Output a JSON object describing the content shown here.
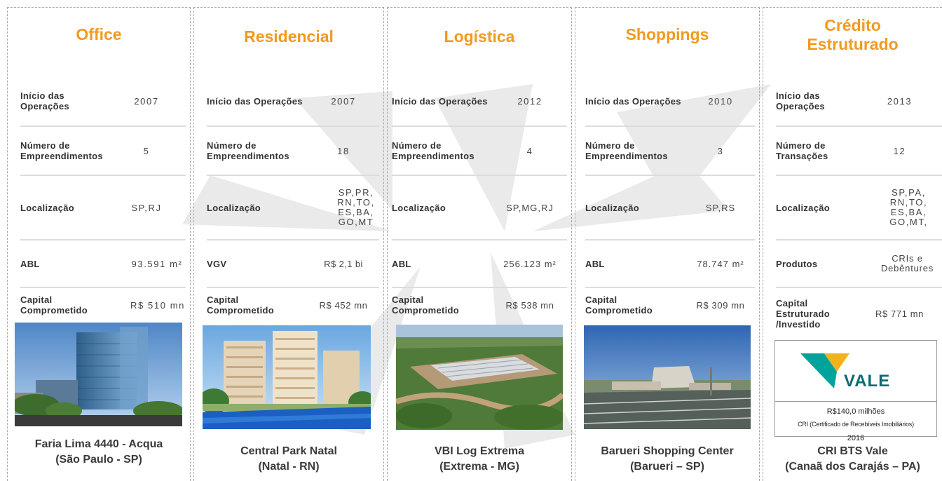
{
  "columns": [
    {
      "title_line1": "Office",
      "title_line2": "",
      "rows": [
        {
          "label": "Início das Operações",
          "value": "2007"
        },
        {
          "label": "Número de Empreendimentos",
          "value": "5"
        },
        {
          "label": "Localização",
          "value": "SP,RJ"
        },
        {
          "label": "ABL",
          "value": "93.591 m²"
        },
        {
          "label": "Capital Comprometido",
          "value": "R$ 510 mn"
        }
      ],
      "photo_icon": "office-tower-photo",
      "caption_line1": "Faria Lima 4440 - Acqua",
      "caption_line2": "(São Paulo - SP)"
    },
    {
      "title_line1": "Residencial",
      "title_line2": "",
      "rows": [
        {
          "label": "Início das Operações",
          "value": "2007"
        },
        {
          "label": "Número de Empreendimentos",
          "value": "18"
        },
        {
          "label": "Localização",
          "value": "SP,PR, RN,TO, ES,BA, GO,MT"
        },
        {
          "label": "VGV",
          "value": "R$ 2,1 bi"
        },
        {
          "label": "Capital Comprometido",
          "value": "R$ 452 mn"
        }
      ],
      "photo_icon": "residential-towers-photo",
      "caption_line1": "Central Park Natal",
      "caption_line2": "(Natal - RN)"
    },
    {
      "title_line1": "Logística",
      "title_line2": "",
      "rows": [
        {
          "label": "Início das Operações",
          "value": "2012"
        },
        {
          "label": "Número de Empreendimentos",
          "value": "4"
        },
        {
          "label": "Localização",
          "value": "SP,MG,RJ"
        },
        {
          "label": "ABL",
          "value": "256.123 m²"
        },
        {
          "label": "Capital Comprometido",
          "value": "R$ 538 mn"
        }
      ],
      "photo_icon": "logistics-warehouse-photo",
      "caption_line1": "VBI Log Extrema",
      "caption_line2": "(Extrema - MG)"
    },
    {
      "title_line1": "Shoppings",
      "title_line2": "",
      "rows": [
        {
          "label": "Início das Operações",
          "value": "2010"
        },
        {
          "label": "Número de Empreendimentos",
          "value": "3"
        },
        {
          "label": "Localização",
          "value": "SP,RS"
        },
        {
          "label": "ABL",
          "value": "78.747 m²"
        },
        {
          "label": "Capital Comprometido",
          "value": "R$ 309 mn"
        }
      ],
      "photo_icon": "shopping-center-photo",
      "caption_line1": "Barueri Shopping Center",
      "caption_line2": "(Barueri – SP)"
    },
    {
      "title_line1": "Crédito",
      "title_line2": "Estruturado",
      "rows": [
        {
          "label": "Início das Operações",
          "value": "2013"
        },
        {
          "label": "Número de Transações",
          "value": "12"
        },
        {
          "label": "Localização",
          "value": "SP,PA, RN,TO, ES,BA, GO,MT,"
        },
        {
          "label": "Produtos",
          "value": "CRIs e Debêntures"
        },
        {
          "label": "Capital Estruturado /Investido",
          "value": "R$ 771 mn"
        }
      ],
      "card": {
        "logo_text": "VALE",
        "amount": "R$140,0 milhões",
        "product": "CRI (Certificado de Recebíveis Imobiliários)",
        "year": "2016"
      },
      "caption_line1": "CRI BTS Vale",
      "caption_line2": "(Canaã dos Carajás – PA)"
    }
  ],
  "colors": {
    "title_orange": "#f29a1e",
    "vale_green": "#00a39b",
    "vale_gold": "#f3b21c",
    "vale_teal": "#0b6b6e",
    "watermark_gray": "#d4d4d4"
  }
}
